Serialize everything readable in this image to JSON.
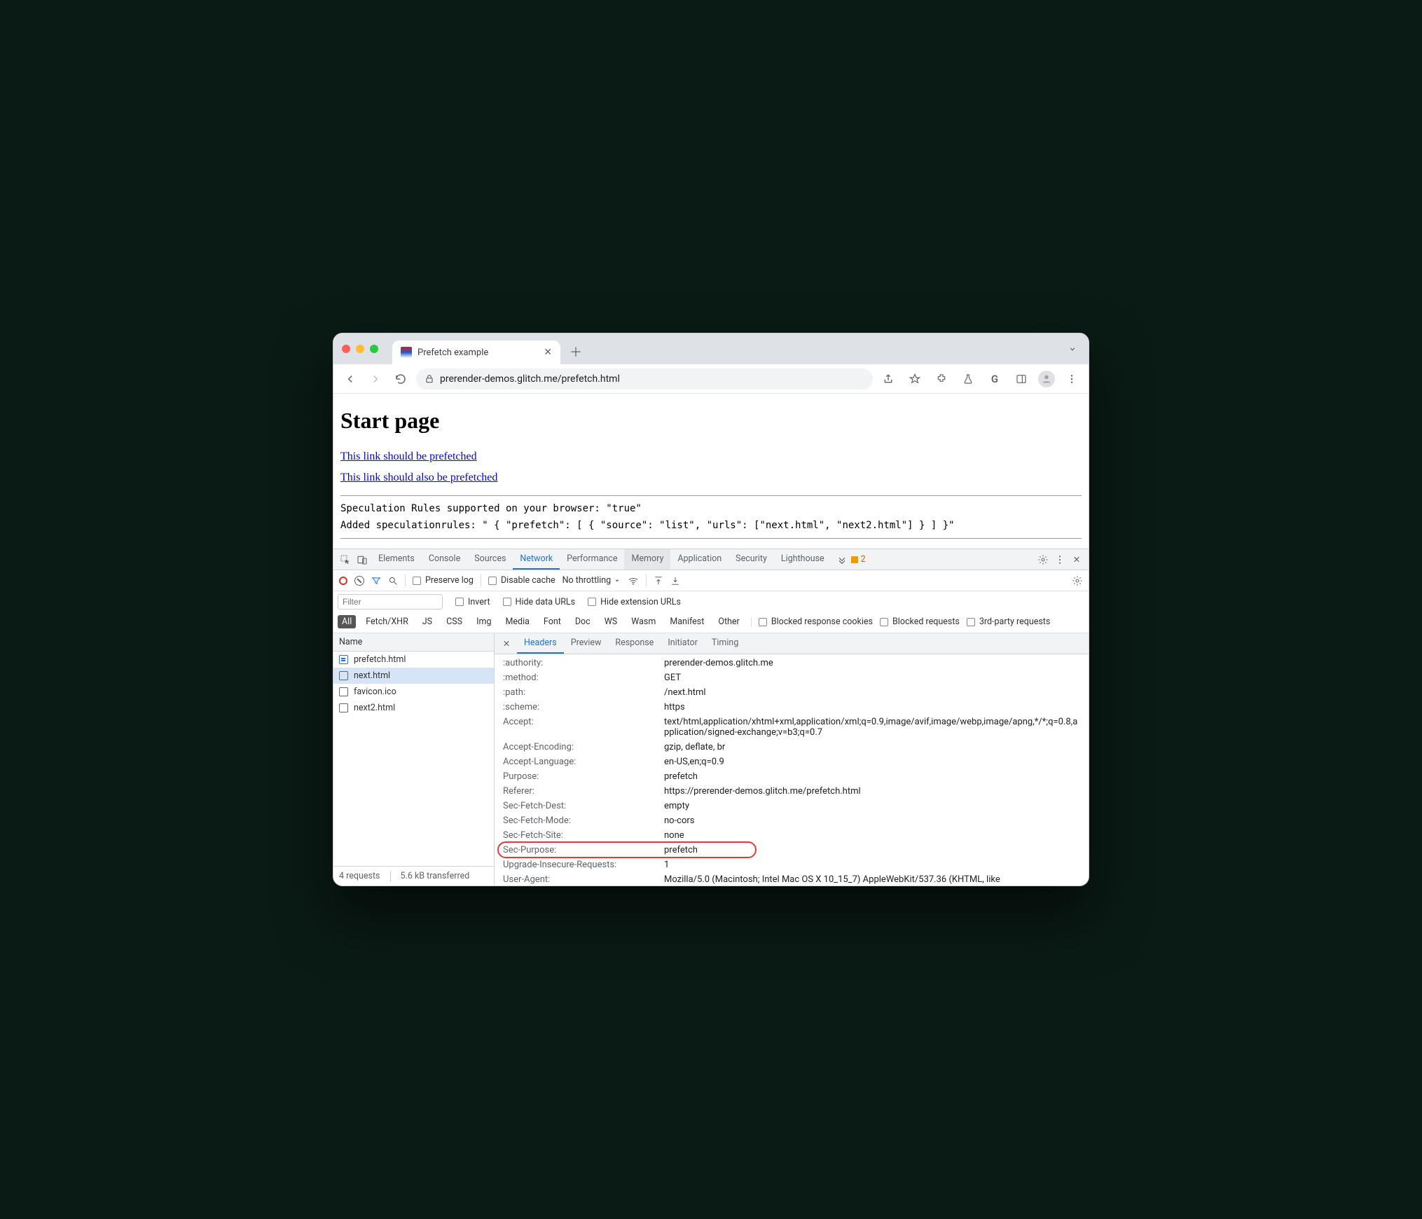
{
  "browser": {
    "tab_title": "Prefetch example",
    "url_display": "prerender-demos.glitch.me/prefetch.html"
  },
  "page": {
    "heading": "Start page",
    "link1": "This link should be prefetched",
    "link2": "This link should also be prefetched",
    "mono1": "Speculation Rules supported on your browser: \"true\"",
    "mono2": "Added speculationrules: \" { \"prefetch\": [ { \"source\": \"list\", \"urls\": [\"next.html\", \"next2.html\"] } ] }\""
  },
  "devtools": {
    "panels": [
      "Elements",
      "Console",
      "Sources",
      "Network",
      "Performance",
      "Memory",
      "Application",
      "Security",
      "Lighthouse"
    ],
    "active_panel": "Network",
    "highlight_panel": "Memory",
    "warn_count": "2",
    "toolbar": {
      "preserve_log": "Preserve log",
      "disable_cache": "Disable cache",
      "throttling": "No throttling"
    },
    "filters": {
      "placeholder": "Filter",
      "invert": "Invert",
      "hide_data": "Hide data URLs",
      "hide_ext": "Hide extension URLs",
      "types": [
        "All",
        "Fetch/XHR",
        "JS",
        "CSS",
        "Img",
        "Media",
        "Font",
        "Doc",
        "WS",
        "Wasm",
        "Manifest",
        "Other"
      ],
      "blocked_cookies": "Blocked response cookies",
      "blocked_requests": "Blocked requests",
      "third_party": "3rd-party requests"
    },
    "list": {
      "header": "Name",
      "items": [
        {
          "name": "prefetch.html",
          "icon": "doc"
        },
        {
          "name": "next.html",
          "icon": "pg",
          "selected": true
        },
        {
          "name": "favicon.ico",
          "icon": "pg"
        },
        {
          "name": "next2.html",
          "icon": "pg"
        }
      ],
      "footer_requests": "4 requests",
      "footer_transfer": "5.6 kB transferred"
    },
    "detail": {
      "tabs": [
        "Headers",
        "Preview",
        "Response",
        "Initiator",
        "Timing"
      ],
      "active": "Headers",
      "headers": [
        {
          "k": ":authority:",
          "v": "prerender-demos.glitch.me"
        },
        {
          "k": ":method:",
          "v": "GET"
        },
        {
          "k": ":path:",
          "v": "/next.html"
        },
        {
          "k": ":scheme:",
          "v": "https"
        },
        {
          "k": "Accept:",
          "v": "text/html,application/xhtml+xml,application/xml;q=0.9,image/avif,image/webp,image/apng,*/*;q=0.8,application/signed-exchange;v=b3;q=0.7"
        },
        {
          "k": "Accept-Encoding:",
          "v": "gzip, deflate, br"
        },
        {
          "k": "Accept-Language:",
          "v": "en-US,en;q=0.9"
        },
        {
          "k": "Purpose:",
          "v": "prefetch"
        },
        {
          "k": "Referer:",
          "v": "https://prerender-demos.glitch.me/prefetch.html"
        },
        {
          "k": "Sec-Fetch-Dest:",
          "v": "empty"
        },
        {
          "k": "Sec-Fetch-Mode:",
          "v": "no-cors"
        },
        {
          "k": "Sec-Fetch-Site:",
          "v": "none"
        },
        {
          "k": "Sec-Purpose:",
          "v": "prefetch",
          "highlight": true
        },
        {
          "k": "Upgrade-Insecure-Requests:",
          "v": "1"
        },
        {
          "k": "User-Agent:",
          "v": "Mozilla/5.0 (Macintosh; Intel Mac OS X 10_15_7) AppleWebKit/537.36 (KHTML, like"
        }
      ]
    }
  }
}
